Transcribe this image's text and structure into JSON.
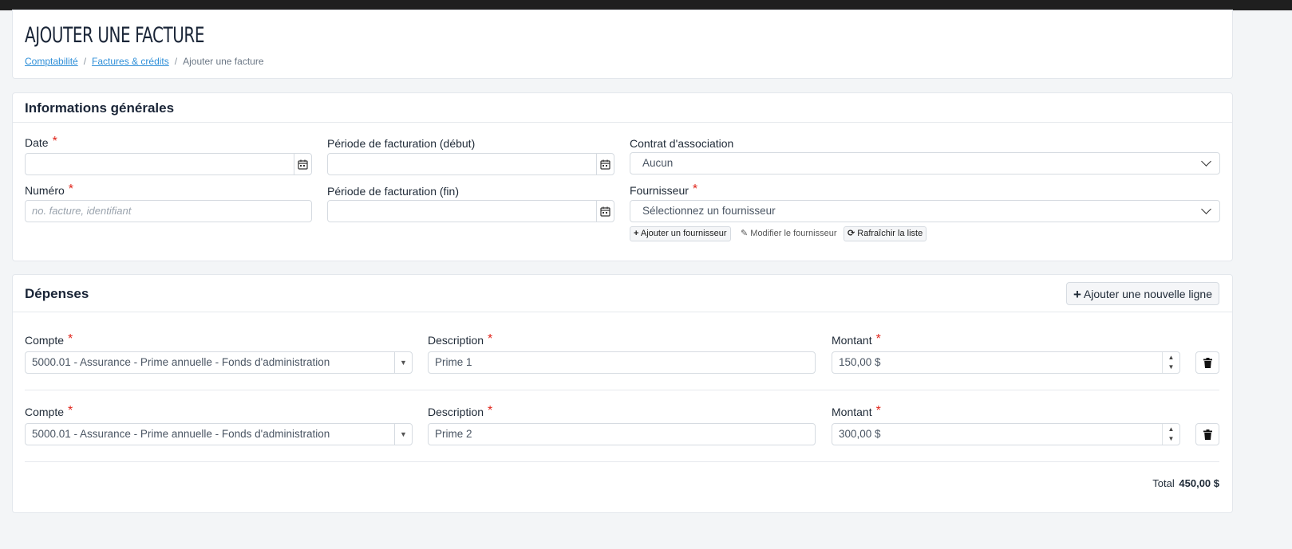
{
  "header": {
    "title": "AJOUTER UNE FACTURE",
    "breadcrumb": [
      "Comptabilité",
      "Factures & crédits",
      "Ajouter une facture"
    ]
  },
  "general": {
    "title": "Informations générales",
    "date_label": "Date",
    "date_value": "",
    "period_start_label": "Période de facturation (début)",
    "period_start_value": "",
    "contract_label": "Contrat d'association",
    "contract_value": "Aucun",
    "number_label": "Numéro",
    "number_placeholder": "no. facture, identifiant",
    "period_end_label": "Période de facturation (fin)",
    "period_end_value": "",
    "supplier_label": "Fournisseur",
    "supplier_value": "Sélectionnez un fournisseur",
    "add_supplier": "Ajouter un fournisseur",
    "edit_supplier": "Modifier le fournisseur",
    "refresh_list": "Rafraîchir la liste"
  },
  "expenses": {
    "title": "Dépenses",
    "add_line": "Ajouter une nouvelle ligne",
    "account_label": "Compte",
    "description_label": "Description",
    "amount_label": "Montant",
    "rows": [
      {
        "account": "5000.01 - Assurance - Prime annuelle - Fonds d'administration",
        "description": "Prime 1",
        "amount": "150,00 $"
      },
      {
        "account": "5000.01 - Assurance - Prime annuelle - Fonds d'administration",
        "description": "Prime 2",
        "amount": "300,00 $"
      }
    ],
    "total_label": "Total",
    "total_value": "450,00 $"
  },
  "colors": {
    "link": "#2f8fd8",
    "required": "#e0241a",
    "topbar": "#1f1f1f"
  }
}
